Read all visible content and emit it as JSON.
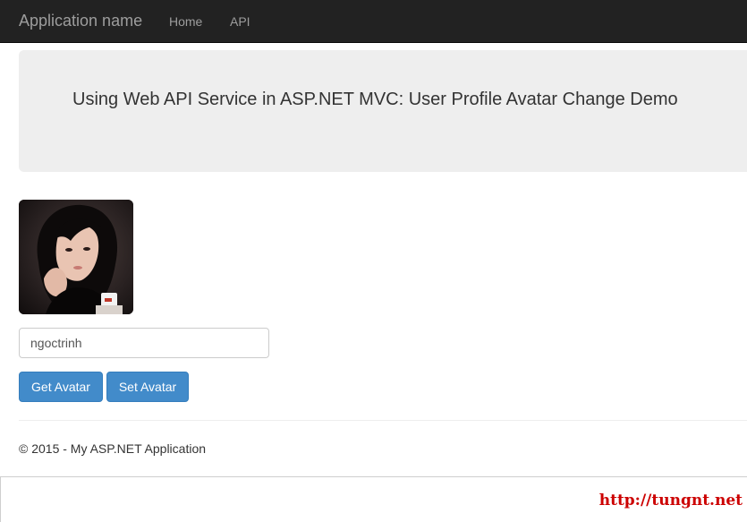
{
  "navbar": {
    "brand": "Application name",
    "links": [
      {
        "label": "Home"
      },
      {
        "label": "API"
      }
    ]
  },
  "jumbotron": {
    "title": "Using Web API Service in ASP.NET MVC: User Profile Avatar Change Demo"
  },
  "avatar": {
    "icon": "user-avatar-photo"
  },
  "form": {
    "username_value": "ngoctrinh",
    "get_avatar_label": "Get Avatar",
    "set_avatar_label": "Set Avatar"
  },
  "footer": {
    "text": "© 2015 - My ASP.NET Application"
  },
  "watermark": {
    "text": "http://tungnt.net"
  },
  "colors": {
    "navbar_bg": "#222222",
    "nav_text": "#9d9d9d",
    "jumbotron_bg": "#eeeeee",
    "button_primary": "#428bca",
    "watermark": "#cc0000"
  }
}
